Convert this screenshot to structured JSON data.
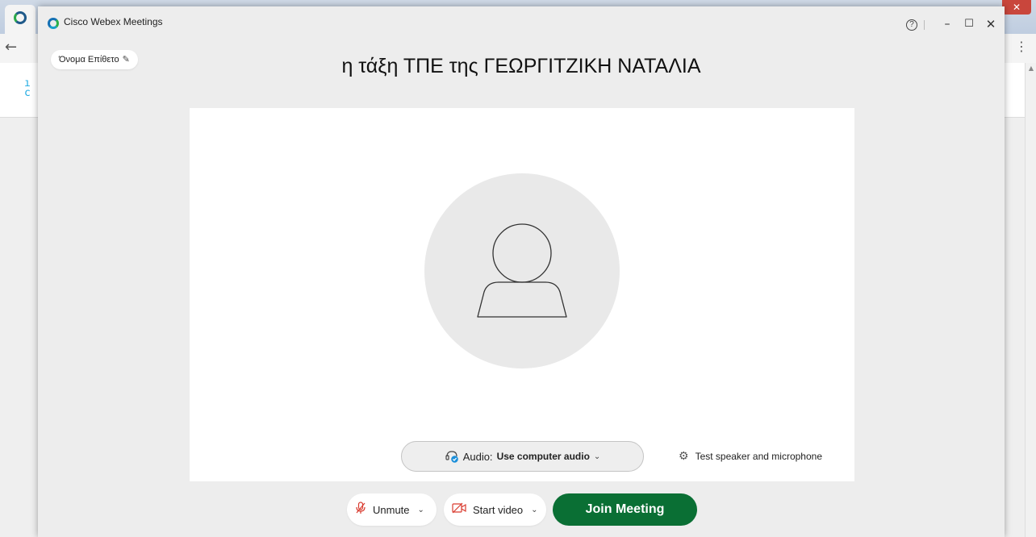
{
  "window": {
    "app_title": "Cisco Webex Meetings",
    "help_glyph": "?",
    "minimize_glyph": "–",
    "maximize_glyph": "☐",
    "close_glyph": "✕"
  },
  "user": {
    "name_label": "Όνομα Επίθετο",
    "edit_icon": "pencil-icon",
    "edit_glyph": "✎"
  },
  "meeting": {
    "title": "η τάξη ΤΠΕ της ΓΕΩΡΓΙΤΖΙΚΗ ΝΑΤΑΛΙΑ"
  },
  "audio": {
    "prefix": "Audio:",
    "option": "Use computer audio",
    "chevron": "⌄"
  },
  "test_speaker": {
    "label": "Test speaker and microphone",
    "icon": "gear-icon",
    "glyph": "⚙"
  },
  "controls": {
    "unmute_label": "Unmute",
    "unmute_icon": "muted-microphone-icon",
    "unmute_glyph": "🎙",
    "start_video_label": "Start video",
    "video_icon": "video-off-icon",
    "video_glyph": "▭",
    "chevron": "⌄",
    "join_label": "Join Meeting"
  },
  "colors": {
    "join_button": "#0a6f34",
    "muted_red": "#d93b2f",
    "background": "#ededed"
  },
  "background_browser": {
    "back_glyph": "←",
    "menu_glyph": "⋮",
    "close_glyph": "✕"
  }
}
